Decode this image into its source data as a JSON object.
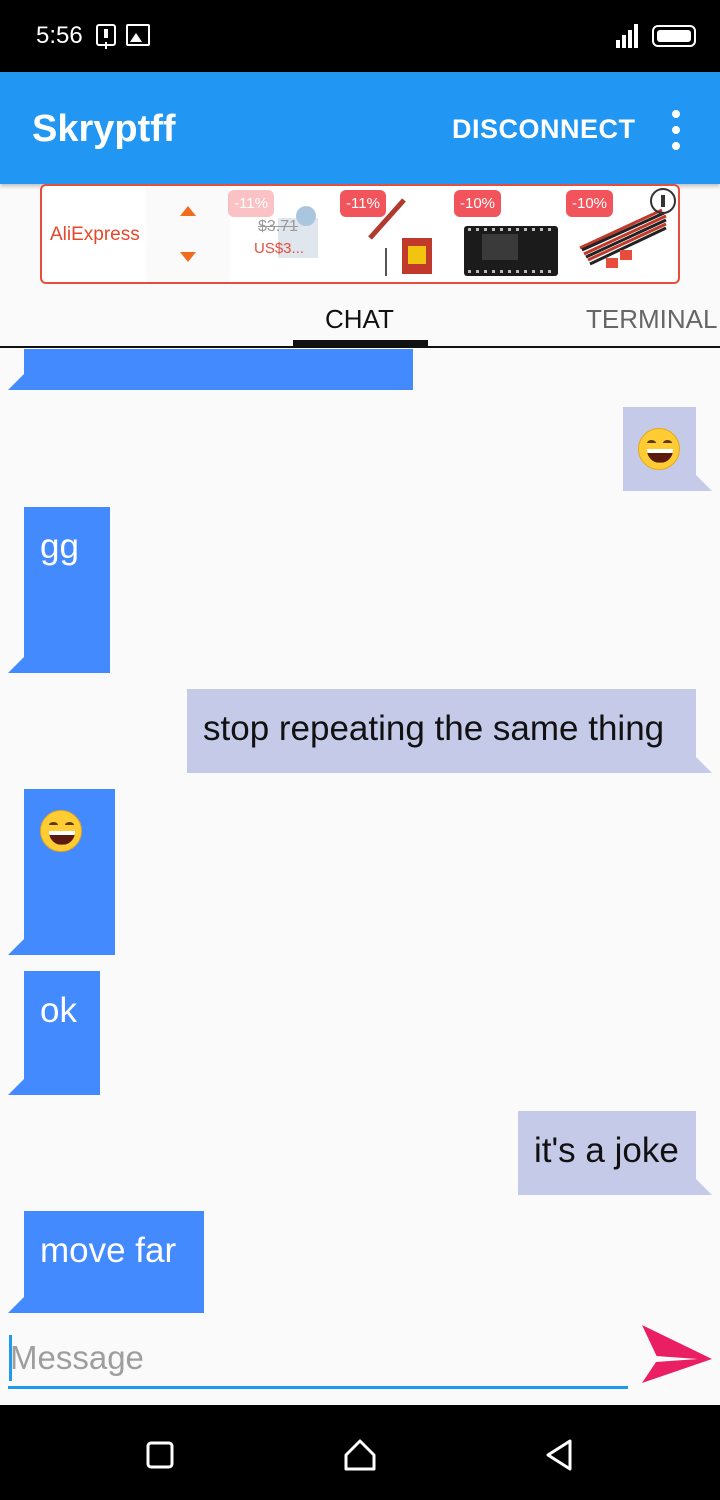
{
  "status_bar": {
    "time": "5:56",
    "icons": [
      "alert-icon",
      "image-icon",
      "signal-icon",
      "battery-icon"
    ]
  },
  "app_bar": {
    "title": "Skryptff",
    "disconnect_label": "DISCONNECT",
    "menu_icon": "more-vert-icon",
    "color": "#2196f3"
  },
  "ad": {
    "logo_text": "AliExpress",
    "items": [
      {
        "badge": "-11%",
        "old_price": "$3.71",
        "price": "US$3..."
      },
      {
        "badge": "-11%"
      },
      {
        "badge": "-10%"
      },
      {
        "badge": "-10%"
      }
    ]
  },
  "tabs": [
    {
      "label": "CHAT",
      "active": true
    },
    {
      "label": "TERMINAL",
      "active": false
    }
  ],
  "messages": [
    {
      "direction": "in",
      "text": ""
    },
    {
      "direction": "out",
      "text": "",
      "emoji": "grinning-face"
    },
    {
      "direction": "in",
      "text": "gg"
    },
    {
      "direction": "out",
      "text": "stop repeating the same thing"
    },
    {
      "direction": "in",
      "text": "",
      "emoji": "grinning-face"
    },
    {
      "direction": "in",
      "text": "ok"
    },
    {
      "direction": "out",
      "text": "it's a joke"
    },
    {
      "direction": "in",
      "text": "move far"
    }
  ],
  "input": {
    "placeholder": "Message",
    "value": ""
  },
  "colors": {
    "incoming_bubble": "#448aff",
    "outgoing_bubble": "#c5cae9",
    "send_icon": "#e91e63",
    "input_underline": "#1e9be9"
  },
  "nav_bar": {
    "buttons": [
      "recents-square-icon",
      "home-icon",
      "back-icon"
    ]
  }
}
